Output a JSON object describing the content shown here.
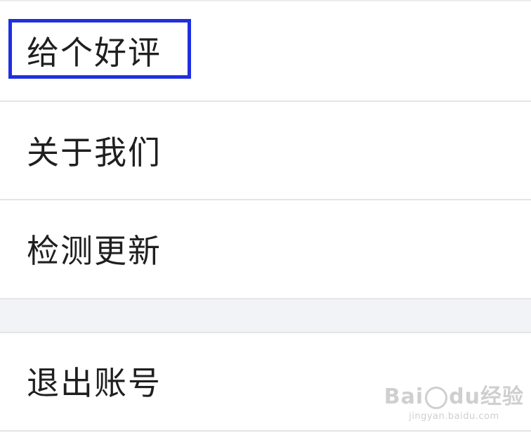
{
  "settings_list": {
    "items": [
      {
        "label": "给个好评"
      },
      {
        "label": "关于我们"
      },
      {
        "label": "检测更新"
      },
      {
        "label": "退出账号"
      }
    ]
  },
  "watermark": {
    "brand_left": "Bai",
    "brand_mid": "du",
    "brand_right": "经验",
    "domain": "jingyan.baidu.com"
  },
  "colors": {
    "highlight": "#1f2fe0",
    "section_gap": "#f1f3f6",
    "text": "#1f1f1f"
  }
}
